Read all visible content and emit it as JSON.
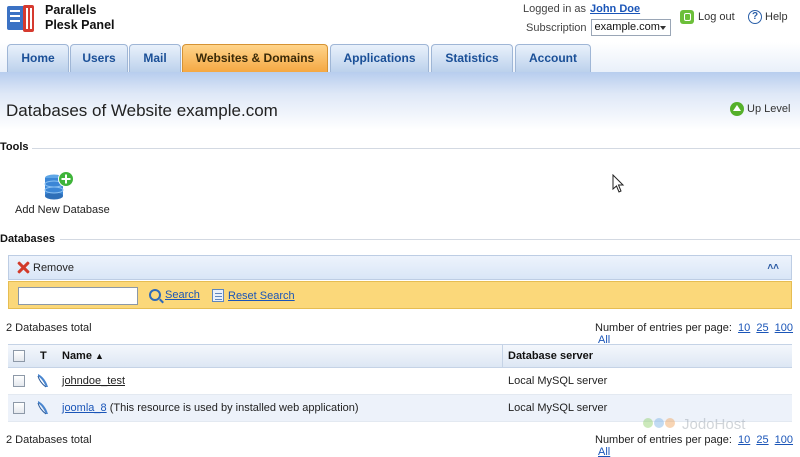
{
  "header": {
    "brand_line1": "Parallels",
    "brand_line2": "Plesk Panel",
    "logged_in_label": "Logged in as",
    "user_name": "John Doe",
    "subscription_label": "Subscription",
    "subscription_value": "example.com",
    "logout_label": "Log out",
    "help_label": "Help"
  },
  "tabs": [
    {
      "label": "Home"
    },
    {
      "label": "Users"
    },
    {
      "label": "Mail"
    },
    {
      "label": "Websites & Domains",
      "active": true
    },
    {
      "label": "Applications"
    },
    {
      "label": "Statistics"
    },
    {
      "label": "Account"
    }
  ],
  "page": {
    "title": "Databases of Website example.com",
    "up_level_label": "Up Level"
  },
  "tools": {
    "section_label": "Tools",
    "add_database_label": "Add New Database"
  },
  "databases": {
    "section_label": "Databases",
    "remove_label": "Remove",
    "search_placeholder": "",
    "search_label": "Search",
    "reset_search_label": "Reset Search",
    "total_text": "2 Databases total",
    "entries_label": "Number of entries per page:",
    "page_sizes": [
      "10",
      "25",
      "100",
      "All"
    ],
    "columns": {
      "type": "T",
      "name": "Name",
      "sort_indicator": "▲",
      "server": "Database server"
    },
    "rows": [
      {
        "name": "johndoe_test",
        "note": "",
        "server": "Local MySQL server"
      },
      {
        "name": "joomla_8",
        "note": "(This resource is used by installed web application)",
        "server": "Local MySQL server"
      }
    ]
  },
  "watermark": "JodoHost",
  "colors": {
    "accent_tab": "#f5a843",
    "tab_blue": "#bcd1ec",
    "search_bar": "#fbd87a",
    "link": "#1a55b8"
  }
}
